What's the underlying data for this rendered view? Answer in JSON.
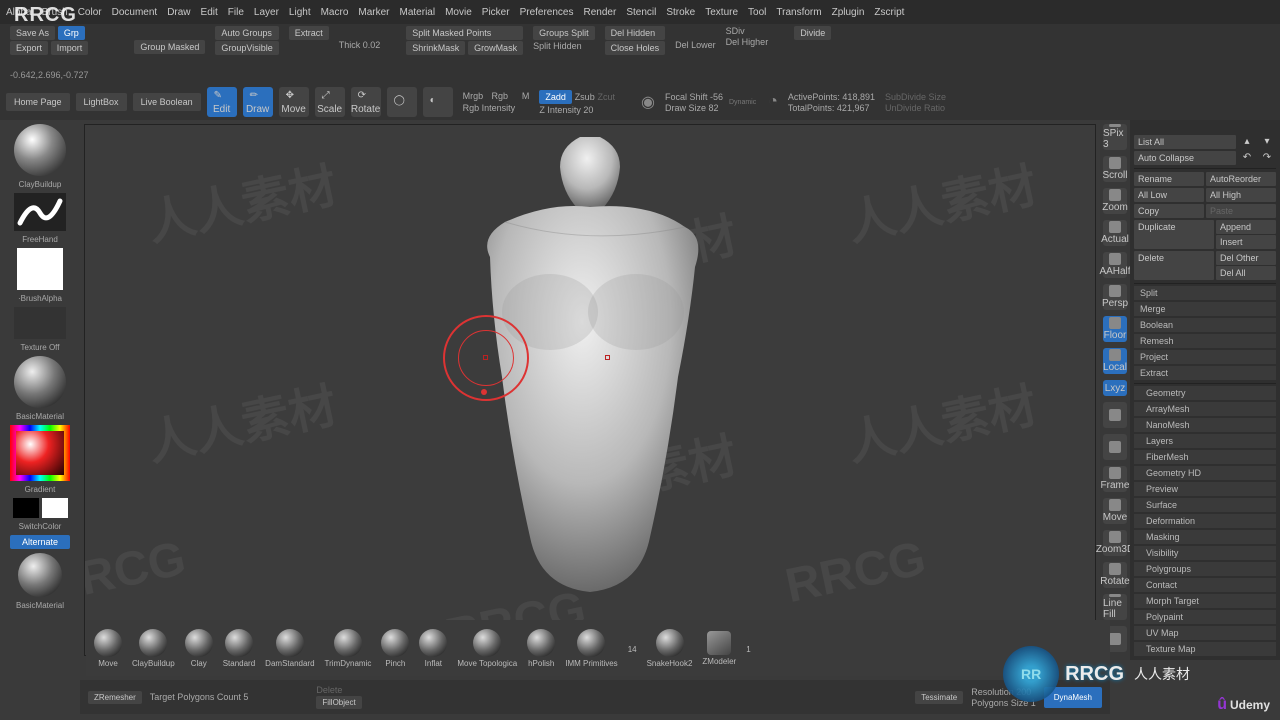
{
  "menu": [
    "Alpha",
    "Brush",
    "Color",
    "Document",
    "Draw",
    "Edit",
    "File",
    "Layer",
    "Light",
    "Macro",
    "Marker",
    "Material",
    "Movie",
    "Picker",
    "Preferences",
    "Render",
    "Stencil",
    "Stroke",
    "Texture",
    "Tool",
    "Transform",
    "Zplugin",
    "Zscript"
  ],
  "second": {
    "saveAs": "Save As",
    "grp": "Grp",
    "export": "Export",
    "import": "Import",
    "groupMasked": "Group Masked",
    "autoGroups": "Auto Groups",
    "groupVisible": "GroupVisible",
    "extract": "Extract",
    "thick": "Thick 0.02",
    "splitMasked": "Split Masked Points",
    "shrinkMask": "ShrinkMask",
    "growMask": "GrowMask",
    "groupsSplit": "Groups Split",
    "splitHidden": "Split Hidden",
    "delHidden": "Del Hidden",
    "closeHoles": "Close Holes",
    "delLower": "Del Lower",
    "sdiv": "SDiv",
    "delHigher": "Del Higher",
    "divide": "Divide"
  },
  "coords": "-0.642,2.696,-0.727",
  "toolrow": {
    "homepage": "Home Page",
    "lightbox": "LightBox",
    "liveboolean": "Live Boolean",
    "edit": "Edit",
    "draw": "Draw",
    "move": "Move",
    "scale": "Scale",
    "rotate": "Rotate",
    "mrgb": "Mrgb",
    "rgb": "Rgb",
    "m": "M",
    "rgbIntensity": "Rgb Intensity",
    "zadd": "Zadd",
    "zsub": "Zsub",
    "zcut": "Zcut",
    "zIntensity": "Z Intensity 20",
    "focalShift": "Focal Shift -56",
    "drawSize": "Draw Size 82",
    "dynamic": "Dynamic",
    "activePoints": "ActivePoints: 418,891",
    "totalPoints": "TotalPoints: 421,967",
    "subdSize": "SubDivide Size",
    "undSize": "UnDivide Ratio"
  },
  "left": {
    "clayBuildup": "ClayBuildup",
    "freeHand": "FreeHand",
    "brushAlpha": "·BrushAlpha",
    "textureOff": "Texture Off",
    "basicMaterial": "BasicMaterial",
    "gradient": "Gradient",
    "switchColor": "SwitchColor",
    "alternate": "Alternate",
    "basicMaterial2": "BasicMaterial"
  },
  "rightNav": [
    "SPix 3",
    "Scroll",
    "Zoom",
    "Actual",
    "AAHalf",
    "Persp",
    "Floor",
    "Local",
    "Lxyz",
    "",
    "",
    "Frame",
    "Move",
    "Zoom3D",
    "Rotate",
    "Line Fill",
    ""
  ],
  "rightPanel": {
    "listAll": "List All",
    "autoCollapse": "Auto Collapse",
    "rename": "Rename",
    "autoReorder": "AutoReorder",
    "allLow": "All Low",
    "allHigh": "All High",
    "copy": "Copy",
    "paste": "Paste",
    "duplicate": "Duplicate",
    "append": "Append",
    "insert": "Insert",
    "delete": "Delete",
    "delOther": "Del Other",
    "delAll": "Del All",
    "split": "Split",
    "merge": "Merge",
    "boolean": "Boolean",
    "remesh": "Remesh",
    "project": "Project",
    "extract": "Extract",
    "sections": [
      "Geometry",
      "ArrayMesh",
      "NanoMesh",
      "Layers",
      "FiberMesh",
      "Geometry HD",
      "Preview",
      "Surface",
      "Deformation",
      "Masking",
      "Visibility",
      "Polygroups",
      "Contact",
      "Morph Target",
      "Polypaint",
      "UV Map",
      "Texture Map"
    ]
  },
  "shelf": [
    "Move",
    "ClayBuildup",
    "Clay",
    "Standard",
    "DamStandard",
    "TrimDynamic",
    "Pinch",
    "Inflat",
    "Move Topologica",
    "hPolish",
    "IMM Primitives",
    "14",
    "SnakeHook2",
    "ZModeler",
    "1"
  ],
  "bottom": {
    "zremesher": "ZRemesher",
    "targetPoly": "Target Polygons Count 5",
    "delete": "Delete",
    "fillObject": "FillObject",
    "tessimate": "Tessimate",
    "polygonsSize": "Polygons Size 1",
    "resolution": "Resolution 200",
    "dynaMesh": "DynaMesh"
  },
  "wm": "人人素材",
  "rrcg": "RRCG",
  "udemy": "Udemy"
}
